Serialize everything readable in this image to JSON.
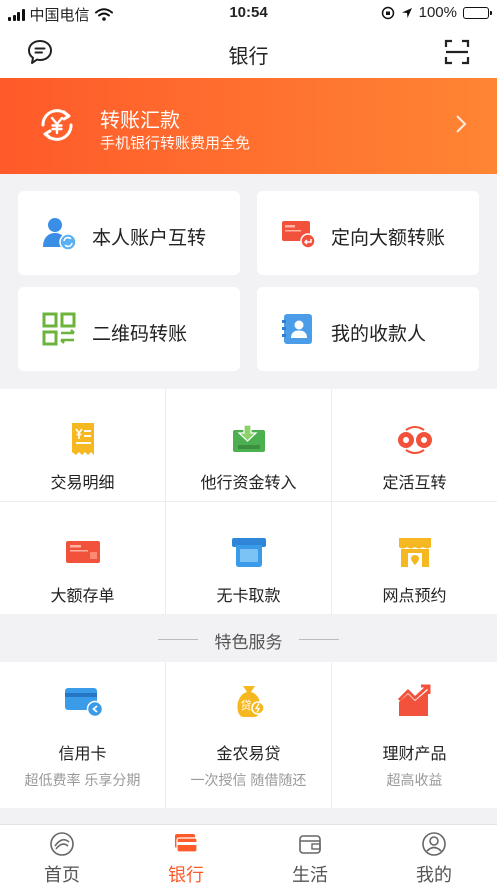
{
  "status_bar": {
    "carrier": "中国电信",
    "time": "10:54",
    "battery": "100%"
  },
  "nav": {
    "title": "银行"
  },
  "banner": {
    "title": "转账汇款",
    "subtitle": "手机银行转账费用全免"
  },
  "quick_actions": [
    {
      "label": "本人账户互转",
      "icon": "user-transfer-icon"
    },
    {
      "label": "定向大额转账",
      "icon": "large-transfer-card-icon"
    },
    {
      "label": "二维码转账",
      "icon": "qr-code-icon"
    },
    {
      "label": "我的收款人",
      "icon": "payee-book-icon"
    }
  ],
  "grid": [
    {
      "label": "交易明细",
      "icon": "receipt-icon"
    },
    {
      "label": "他行资金转入",
      "icon": "wallet-in-icon"
    },
    {
      "label": "定活互转",
      "icon": "fixed-current-swap-icon"
    },
    {
      "label": "大额存单",
      "icon": "deposit-certificate-icon"
    },
    {
      "label": "无卡取款",
      "icon": "atm-cardless-icon"
    },
    {
      "label": "网点预约",
      "icon": "branch-store-icon"
    }
  ],
  "featured": {
    "title": "特色服务",
    "items": [
      {
        "label": "信用卡",
        "sub": "超低费率 乐享分期",
        "icon": "credit-card-icon"
      },
      {
        "label": "金农易贷",
        "sub": "一次授信 随借随还",
        "icon": "loan-bag-icon"
      },
      {
        "label": "理财产品",
        "sub": "超高收益",
        "icon": "trend-chart-icon"
      }
    ]
  },
  "tabs": [
    {
      "label": "首页",
      "icon": "home-icon",
      "active": false
    },
    {
      "label": "银行",
      "icon": "bank-card-icon",
      "active": true
    },
    {
      "label": "生活",
      "icon": "life-wallet-icon",
      "active": false
    },
    {
      "label": "我的",
      "icon": "profile-icon",
      "active": false
    }
  ],
  "colors": {
    "accent": "#ff5a2a",
    "banner_start": "#ff5a2a",
    "banner_end": "#ff8533",
    "background": "#f2f2f4"
  }
}
